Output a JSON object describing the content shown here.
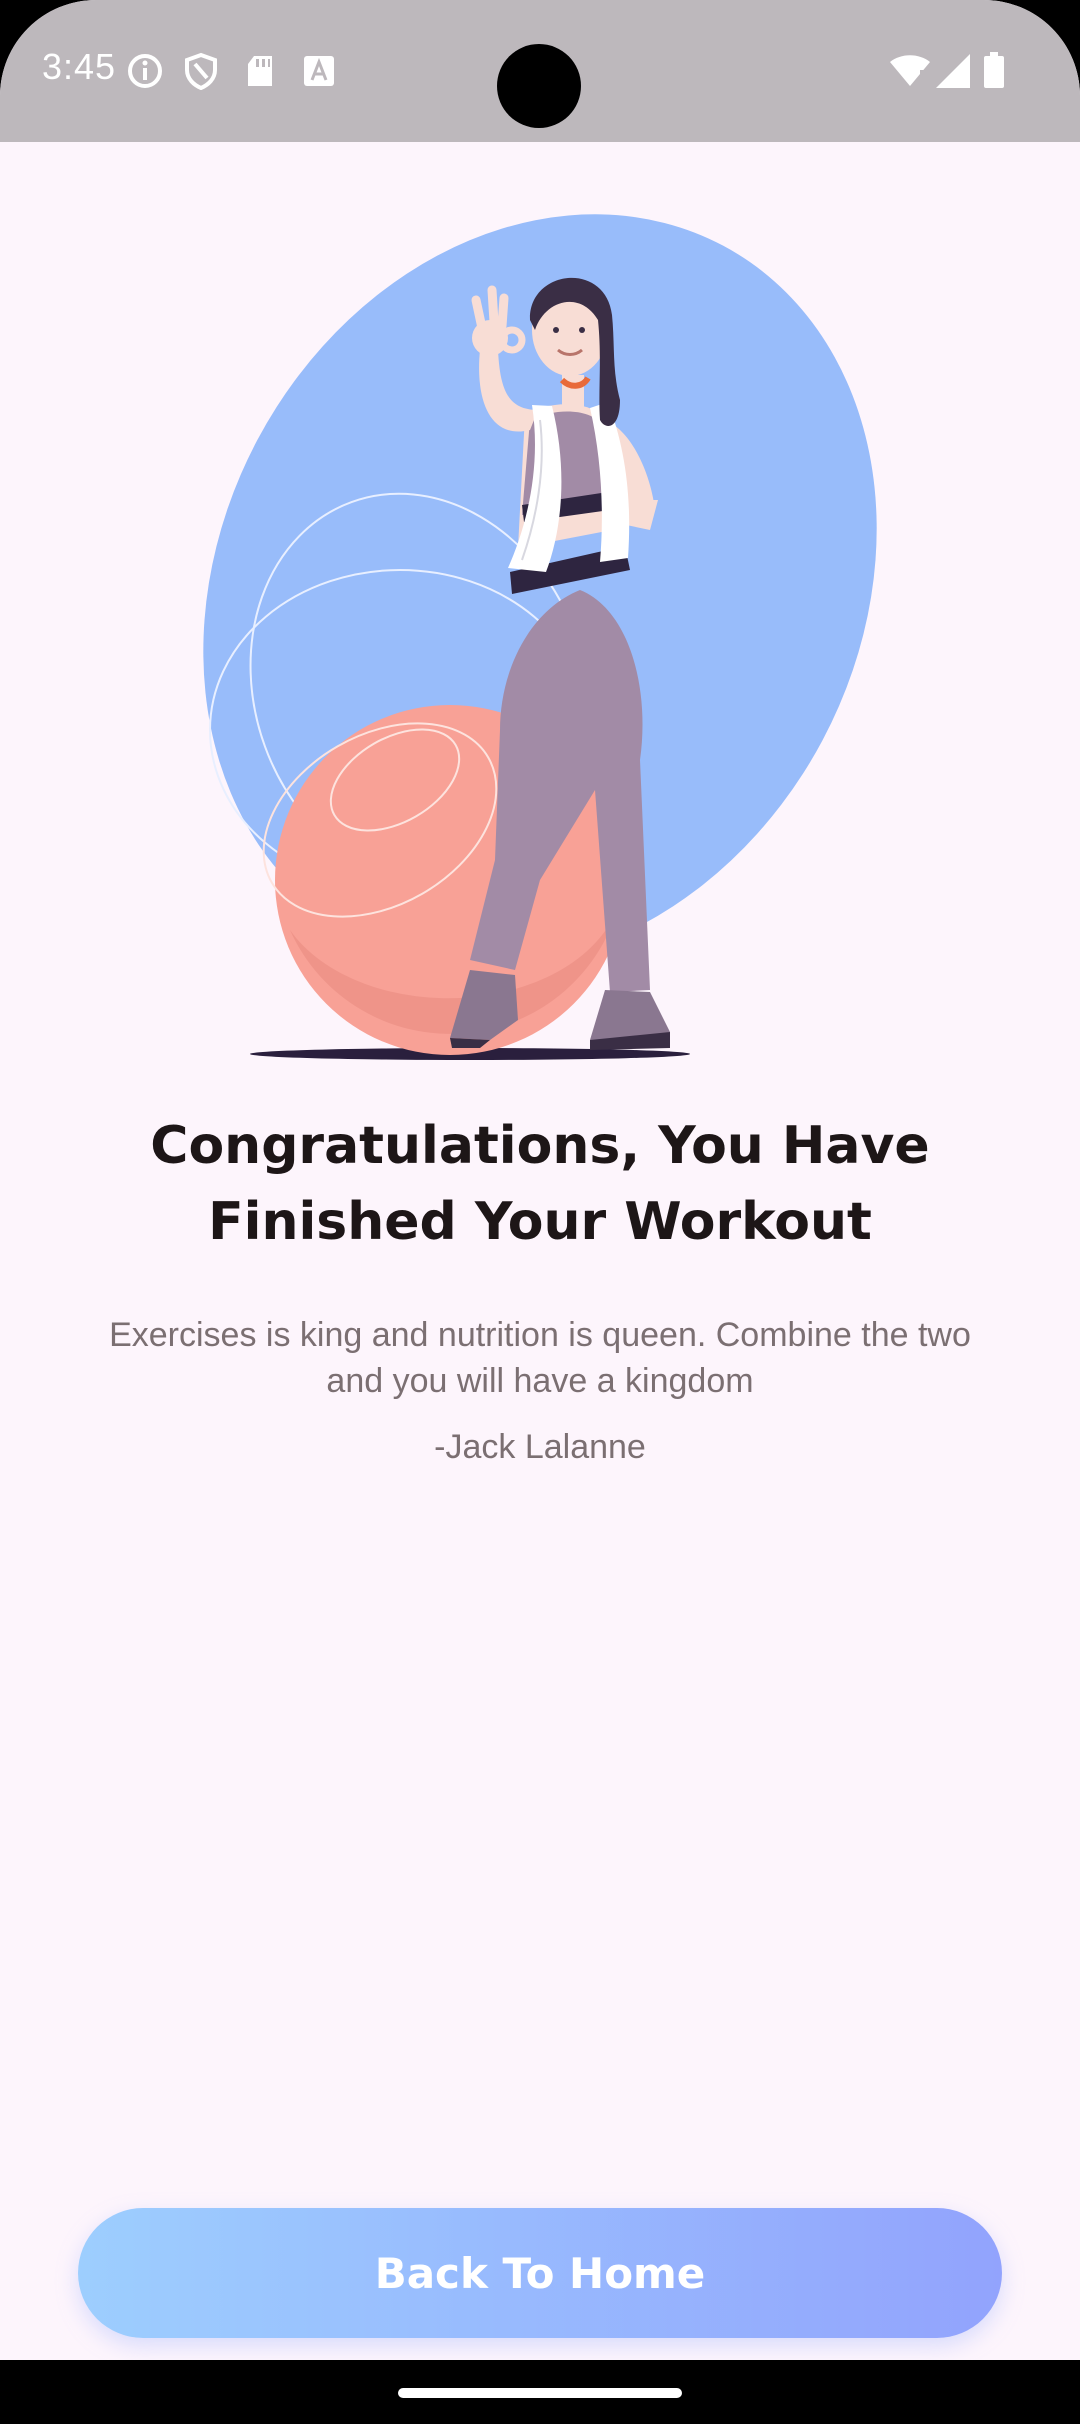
{
  "status_bar": {
    "time": "3:45",
    "left_icons": [
      "info-icon",
      "shield-icon",
      "sd-card-icon",
      "font-a-icon"
    ],
    "right_icons": [
      "wifi-icon",
      "signal-icon",
      "battery-icon"
    ]
  },
  "colors": {
    "background": "#fdf5fc",
    "title": "#1d1617",
    "body_text": "#7b6f72",
    "button_gradient_start": "#9dcefe",
    "button_gradient_end": "#92a3fd",
    "blob": "#98bcfa",
    "ball": "#f8a196"
  },
  "content": {
    "title": "Congratulations, You Have Finished Your Workout",
    "quote": "Exercises is king and nutrition is queen. Combine the two and you will have a kingdom",
    "author": "-Jack Lalanne"
  },
  "button": {
    "label": "Back To Home"
  }
}
